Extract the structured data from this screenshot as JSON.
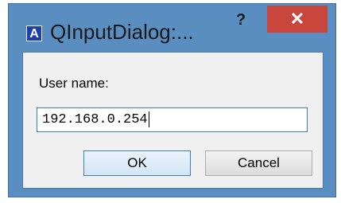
{
  "window": {
    "title": "QInputDialog:...",
    "app_icon_letter": "A",
    "help_label": "?",
    "close_label": "✕"
  },
  "dialog": {
    "label": "User name:",
    "input_value": "192.168.0.254",
    "ok_label": "OK",
    "cancel_label": "Cancel"
  },
  "colors": {
    "frame": "#5b8ec0",
    "close_button": "#c9463c",
    "client_bg": "#f0f0f0",
    "focus_border": "#3c7fb1"
  }
}
